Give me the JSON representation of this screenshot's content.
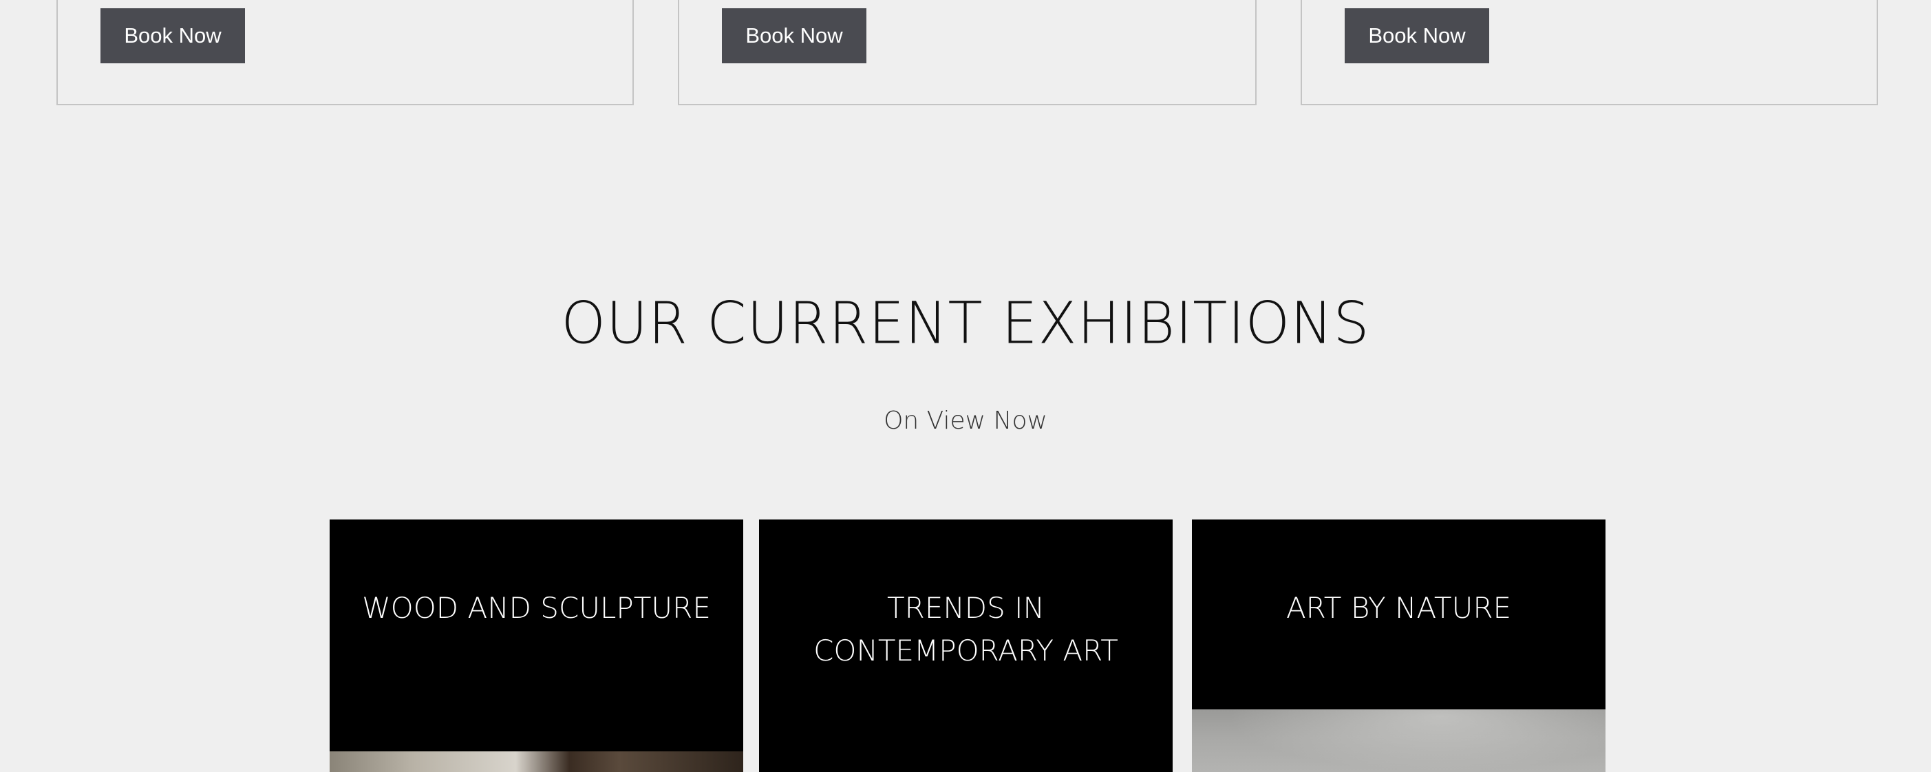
{
  "booking_cards": [
    {
      "button_label": "Book Now"
    },
    {
      "button_label": "Book Now"
    },
    {
      "button_label": "Book Now"
    }
  ],
  "exhibitions_section": {
    "title": "OUR CURRENT EXHIBITIONS",
    "subtitle": "On View Now",
    "items": [
      {
        "title": "WOOD AND SCULPTURE"
      },
      {
        "title": "TRENDS IN CONTEMPORARY ART"
      },
      {
        "title": "ART BY NATURE"
      }
    ]
  },
  "colors": {
    "page_background": "#efefef",
    "button_background": "#4a4b51",
    "button_text": "#ffffff",
    "card_border": "#c4c4c4",
    "tile_background": "#000000",
    "tile_text": "#ffffff",
    "heading_text": "#111111"
  }
}
